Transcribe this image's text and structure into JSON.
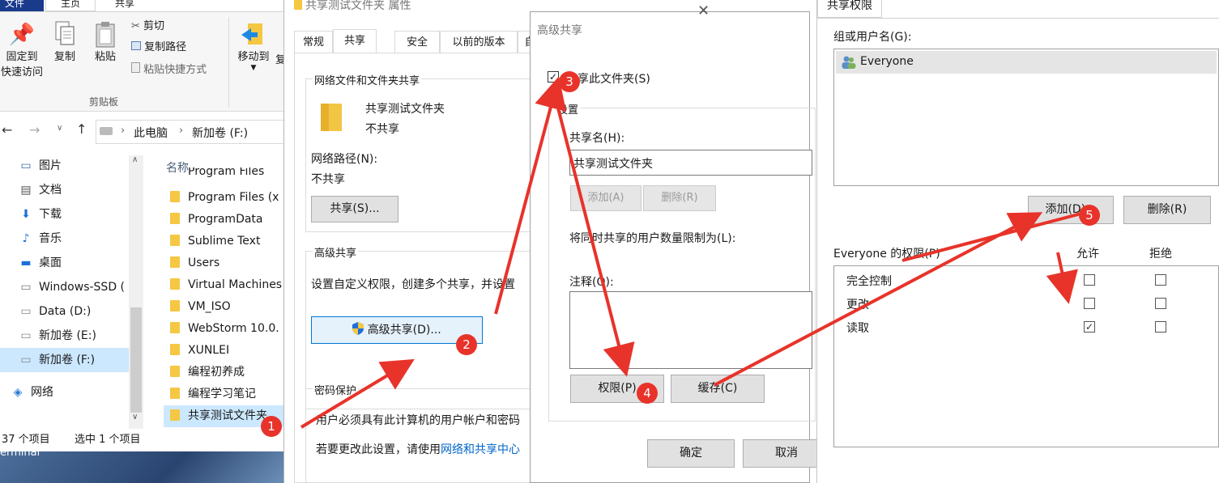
{
  "explorer": {
    "ribbon_tabs": [
      "文件",
      "主页",
      "共享"
    ],
    "pin_label": "固定到",
    "pin_label2": "快速访问",
    "copy_label": "复制",
    "paste_label": "粘贴",
    "cut_label": "剪切",
    "copy_path_label": "复制路径",
    "paste_shortcut_label": "粘贴快捷方式",
    "clipboard_group": "剪贴板",
    "move_label": "移动到",
    "copy_to_partial": "复",
    "breadcrumb": [
      "此电脑",
      "新加卷 (F:)"
    ],
    "nav_items": [
      {
        "label": "图片",
        "icon": "pictures-icon"
      },
      {
        "label": "文档",
        "icon": "documents-icon"
      },
      {
        "label": "下载",
        "icon": "download-icon"
      },
      {
        "label": "音乐",
        "icon": "music-icon"
      },
      {
        "label": "桌面",
        "icon": "desktop-icon"
      },
      {
        "label": "Windows-SSD (",
        "icon": "drive-windows-icon"
      },
      {
        "label": "Data (D:)",
        "icon": "drive-icon"
      },
      {
        "label": "新加卷 (E:)",
        "icon": "drive-icon"
      },
      {
        "label": "新加卷 (F:)",
        "icon": "drive-icon"
      },
      {
        "label": "网络",
        "icon": "network-icon"
      }
    ],
    "column_header": "名称",
    "files_partial_top": "Program Files",
    "files": [
      "Program Files (x",
      "ProgramData",
      "Sublime Text",
      "Users",
      "Virtual Machines",
      "VM_ISO",
      "WebStorm 10.0.",
      "XUNLEI",
      "编程初养成",
      "编程学习笔记",
      "共享测试文件夹"
    ],
    "status_count": "37 个项目",
    "status_selected": "选中 1 个项目",
    "taskbar_text": "erminal"
  },
  "props": {
    "title": "共享测试文件夹 属性",
    "tabs": [
      "常规",
      "共享",
      "安全",
      "以前的版本",
      "自"
    ],
    "network_share_group": "网络文件和文件夹共享",
    "folder_name": "共享测试文件夹",
    "share_status": "不共享",
    "network_path_label": "网络路径(N):",
    "network_path_value": "不共享",
    "share_button": "共享(S)...",
    "advanced_group": "高级共享",
    "advanced_desc": "设置自定义权限，创建多个共享，并设置",
    "advanced_button": "高级共享(D)...",
    "password_group": "密码保护",
    "password_desc": "用户必须具有此计算机的用户帐户和密码",
    "change_setting_prefix": "若要更改此设置，请使用",
    "change_setting_link": "网络和共享中心"
  },
  "adv": {
    "title": "高级共享",
    "share_checkbox_label": "共享此文件夹(S)",
    "settings_label": "设置",
    "share_name_label": "共享名(H):",
    "share_name_value": "共享测试文件夹",
    "add_button": "添加(A)",
    "remove_button": "删除(R)",
    "limit_label": "将同时共享的用户数量限制为(L):",
    "comment_label": "注释(O):",
    "permissions_button": "权限(P)",
    "caching_button": "缓存(C)",
    "ok_button": "确定",
    "cancel_button": "取消"
  },
  "perm": {
    "tab": "共享权限",
    "group_label": "组或用户名(G):",
    "users": [
      "Everyone"
    ],
    "add_button": "添加(D)...",
    "remove_button": "删除(R)",
    "perm_label": "Everyone 的权限(P)",
    "allow_header": "允许",
    "deny_header": "拒绝",
    "permissions": [
      {
        "name": "完全控制",
        "allow": false,
        "deny": false
      },
      {
        "name": "更改",
        "allow": false,
        "deny": false
      },
      {
        "name": "读取",
        "allow": true,
        "deny": false
      }
    ]
  },
  "badges": [
    "1",
    "2",
    "3",
    "4",
    "5"
  ],
  "colors": {
    "annotation": "#e8332a",
    "selection": "#cce8ff",
    "accent": "#0078d7"
  }
}
